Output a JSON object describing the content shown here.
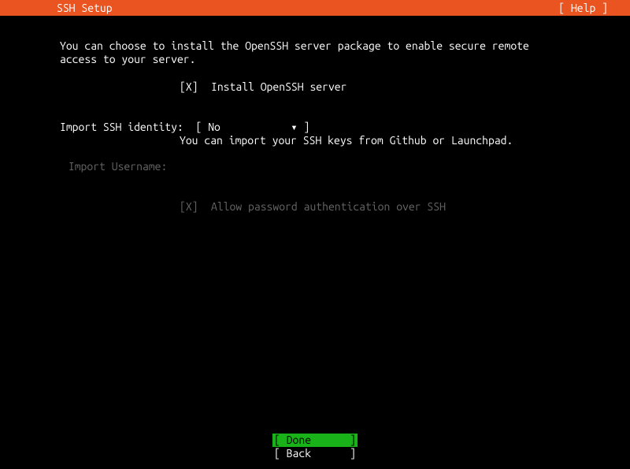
{
  "header": {
    "title": "SSH Setup",
    "help": "[ Help ]"
  },
  "intro": "You can choose to install the OpenSSH server package to enable secure remote access to your server.",
  "install_openssh": {
    "check": "[X]",
    "label": "Install OpenSSH server"
  },
  "import_identity": {
    "label": "Import SSH identity:",
    "value": "No",
    "bracket_open": "[ ",
    "bracket_close": "▾ ]",
    "hint": "You can import your SSH keys from Github or Launchpad."
  },
  "import_username": {
    "label": "Import Username:"
  },
  "allow_password": {
    "check": "[X]",
    "label": "Allow password authentication over SSH"
  },
  "footer": {
    "done": {
      "bracket_open": "[ ",
      "label": "Done",
      "bracket_close": "]"
    },
    "back": {
      "bracket_open": "[ ",
      "label": "Back",
      "bracket_close": "]"
    }
  }
}
